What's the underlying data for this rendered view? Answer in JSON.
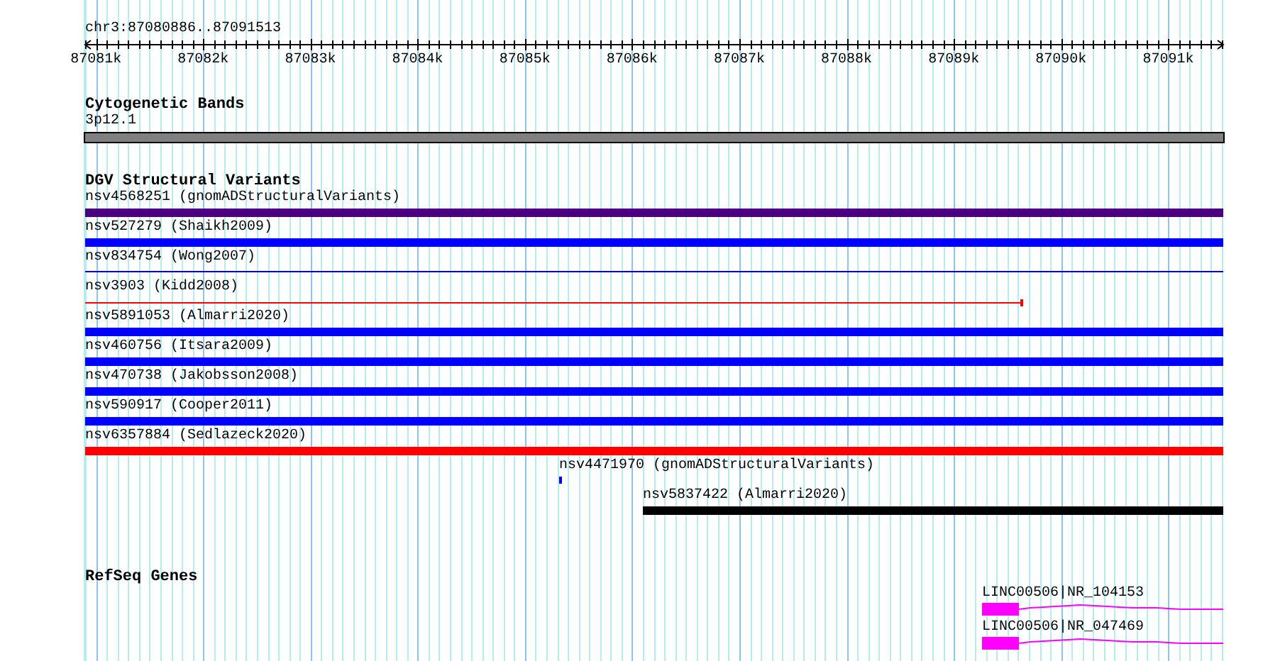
{
  "location": "chr3:87080886..87091513",
  "ruler": {
    "ticks": [
      "87081k",
      "87082k",
      "87083k",
      "87084k",
      "87085k",
      "87086k",
      "87087k",
      "87088k",
      "87089k",
      "87090k",
      "87091k"
    ]
  },
  "tracks": [
    {
      "kind": "cytoband",
      "title": "Cytogenetic Bands",
      "features": [
        {
          "label": "3p12.1",
          "kind": "bar",
          "color": "#808080"
        }
      ]
    },
    {
      "kind": "variants",
      "title": "DGV Structural Variants",
      "features": [
        {
          "label": "nsv4568251 (gnomADStructuralVariants)",
          "kind": "bar",
          "color": "#4b0082"
        },
        {
          "label": "nsv527279 (Shaikh2009)",
          "kind": "bar",
          "color": "#0000ff"
        },
        {
          "label": "nsv834754 (Wong2007)",
          "kind": "line",
          "color": "#0000cd"
        },
        {
          "label": "nsv3903 (Kidd2008)",
          "kind": "capped",
          "color": "#ff0000"
        },
        {
          "label": "nsv5891053 (Almarri2020)",
          "kind": "bar",
          "color": "#0000ff"
        },
        {
          "label": "nsv460756 (Itsara2009)",
          "kind": "bar",
          "color": "#0000ff"
        },
        {
          "label": "nsv470738 (Jakobsson2008)",
          "kind": "bar",
          "color": "#0000ff"
        },
        {
          "label": "nsv590917 (Cooper2011)",
          "kind": "bar",
          "color": "#0000ff"
        },
        {
          "label": "nsv6357884 (Sedlazeck2020)",
          "kind": "bar",
          "color": "#ff0000"
        },
        {
          "label": "nsv4471970 (gnomADStructuralVariants)",
          "kind": "tick",
          "color": "#0000ff"
        },
        {
          "label": "nsv5837422 (Almarri2020)",
          "kind": "bar",
          "color": "#000000"
        }
      ]
    },
    {
      "kind": "genes",
      "title": "RefSeq Genes",
      "features": [
        {
          "label": "LINC00506|NR_104153",
          "kind": "transcript",
          "color": "#ff00ff"
        },
        {
          "label": "LINC00506|NR_047469",
          "kind": "transcript",
          "color": "#ff00ff"
        }
      ]
    }
  ]
}
